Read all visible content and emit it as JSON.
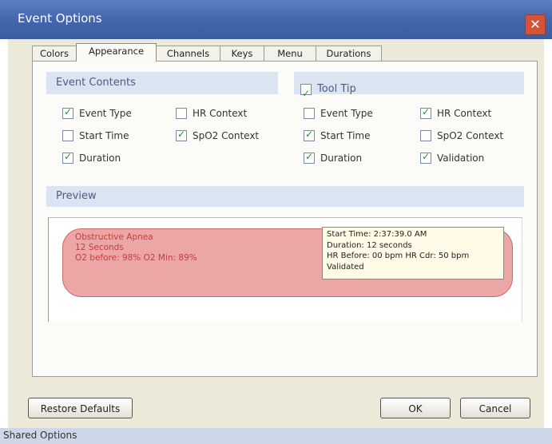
{
  "window": {
    "title": "Event Options",
    "close_glyph": "✕"
  },
  "tabs": [
    {
      "label": "Colors",
      "active": false
    },
    {
      "label": "Appearance",
      "active": true
    },
    {
      "label": "Channels",
      "active": false
    },
    {
      "label": "Keys",
      "active": false
    },
    {
      "label": "Menu",
      "active": false
    },
    {
      "label": "Durations",
      "active": false
    }
  ],
  "event_contents": {
    "header": "Event Contents",
    "items": [
      {
        "label": "Event Type",
        "checked": true
      },
      {
        "label": "HR Context",
        "checked": false
      },
      {
        "label": "Start Time",
        "checked": false
      },
      {
        "label": "SpO2 Context",
        "checked": true
      },
      {
        "label": "Duration",
        "checked": true
      }
    ]
  },
  "tool_tip": {
    "header": "Tool Tip",
    "enabled": true,
    "items": [
      {
        "label": "Event Type",
        "checked": false
      },
      {
        "label": "HR Context",
        "checked": true
      },
      {
        "label": "Start Time",
        "checked": true
      },
      {
        "label": "SpO2 Context",
        "checked": false
      },
      {
        "label": "Duration",
        "checked": true
      },
      {
        "label": "Validation",
        "checked": true
      }
    ]
  },
  "preview": {
    "header": "Preview",
    "event_lines": [
      "Obstructive Apnea",
      "12 Seconds",
      "O2 before: 98%   O2 Min: 89%"
    ],
    "tooltip_lines": [
      "Start Time: 2:37:39.0 AM",
      "Duration: 12 seconds",
      "HR Before: 00 bpm   HR Cdr: 50 bpm",
      "Validated"
    ]
  },
  "buttons": {
    "restore": "Restore Defaults",
    "ok": "OK",
    "cancel": "Cancel"
  },
  "status": {
    "text": "Shared Options"
  },
  "colors": {
    "title_bar": "#4466ad",
    "event_fill": "#eda6a6",
    "event_text": "#c04040",
    "section_header": "#dbe4f1"
  }
}
